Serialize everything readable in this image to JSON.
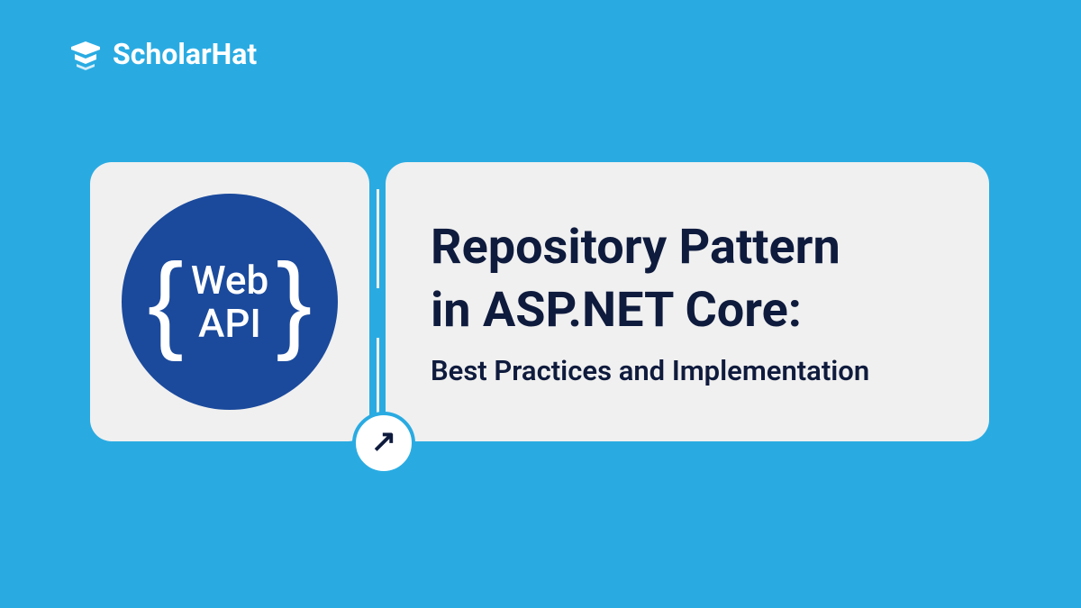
{
  "logo": {
    "brand_name": "ScholarHat"
  },
  "badge": {
    "line1": "Web",
    "line2": "API"
  },
  "content": {
    "title_line1": "Repository Pattern",
    "title_line2": "in ASP.NET Core:",
    "subtitle": "Best Practices and Implementation"
  },
  "colors": {
    "background": "#29ABE2",
    "card_bg": "#F0F0F0",
    "badge_bg": "#1B4A9C",
    "text_dark": "#0F1B3D"
  }
}
